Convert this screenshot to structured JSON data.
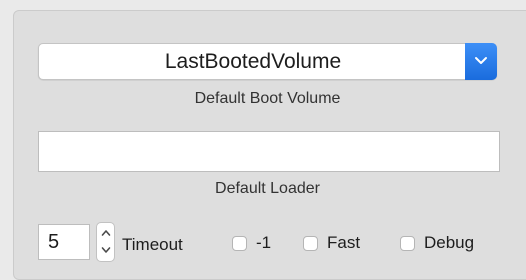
{
  "boot_volume": {
    "selected": "LastBootedVolume",
    "caption": "Default Boot Volume"
  },
  "loader": {
    "value": "",
    "caption": "Default Loader"
  },
  "timeout": {
    "value": "5",
    "label": "Timeout"
  },
  "checkboxes": [
    {
      "label": "-1",
      "checked": false
    },
    {
      "label": "Fast",
      "checked": false
    },
    {
      "label": "Debug",
      "checked": false
    }
  ],
  "colors": {
    "accent": "#2a7ae8",
    "panel": "#dedede"
  },
  "icons": {
    "popup_arrow": "chevron-down-icon",
    "stepper_up": "chevron-up-icon",
    "stepper_down": "chevron-down-icon"
  }
}
